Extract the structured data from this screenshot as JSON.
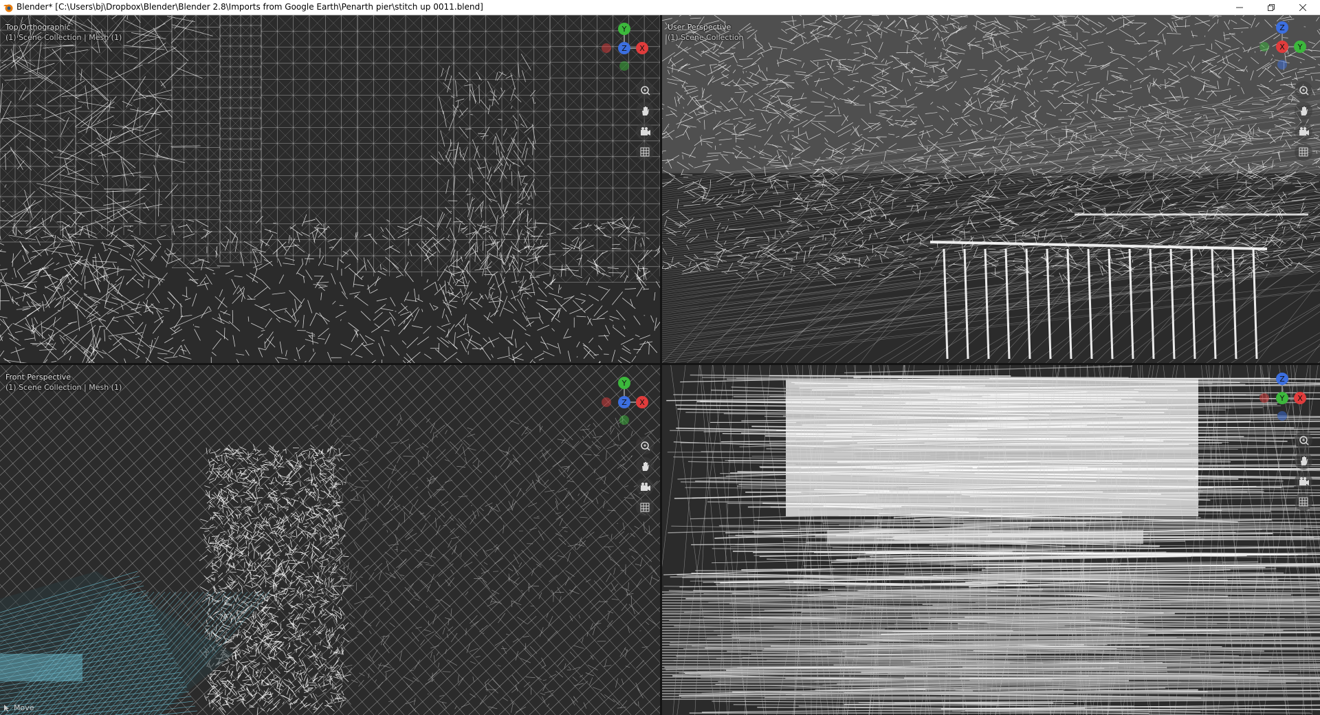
{
  "window": {
    "title": "Blender* [C:\\Users\\bj\\Dropbox\\Blender\\Blender 2.8\\Imports from Google Earth\\Penarth pier\\stitch up 0011.blend]",
    "controls": [
      "minimize-icon",
      "restore-icon",
      "close-icon"
    ]
  },
  "viewports": [
    {
      "id": "top-left",
      "view_name": "Top Orthographic",
      "collection": "(1) Scene Collection | Mesh (1)",
      "shading": "wireframe",
      "gizmo_axes": [
        "Y",
        "X",
        "Z"
      ]
    },
    {
      "id": "top-right",
      "view_name": "User Perspective",
      "collection": "(1) Scene Collection",
      "shading": "wireframe",
      "gizmo_axes": [
        "Z",
        "Y",
        "X"
      ]
    },
    {
      "id": "bottom-left",
      "view_name": "Front Perspective",
      "collection": "(1) Scene Collection | Mesh (1)",
      "shading": "wireframe",
      "gizmo_axes": [
        "Y",
        "X",
        "Z"
      ]
    },
    {
      "id": "bottom-right",
      "view_name": "",
      "collection": "",
      "shading": "wireframe",
      "gizmo_axes": [
        "Z",
        "X",
        "Y"
      ]
    }
  ],
  "nav_tools": [
    "zoom-icon",
    "hand-pan-icon",
    "camera-icon",
    "grid-icon"
  ],
  "status_bar": {
    "operation": "Move"
  },
  "colors": {
    "background": "#2b2b2b",
    "wire": "#d8d8d8",
    "wire_selected": "#6fc4d8",
    "axis_x": "#e03c3c",
    "axis_y": "#3cb83c",
    "axis_z": "#3c6fe0"
  }
}
